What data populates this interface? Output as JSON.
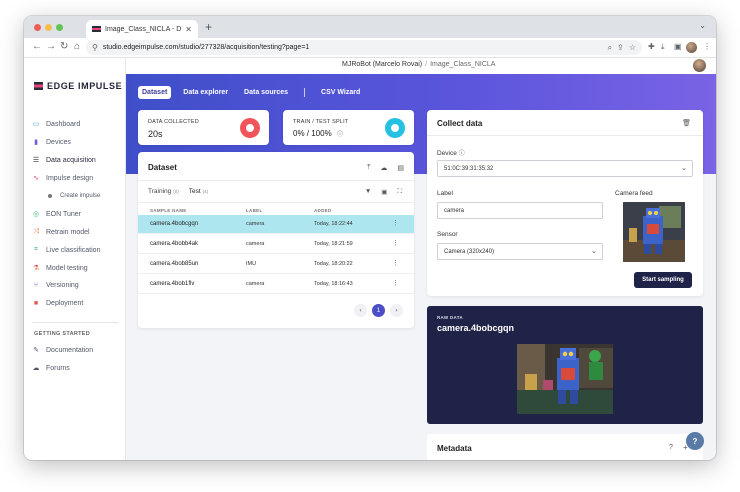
{
  "browser": {
    "tab_title": "Image_Class_NICLA - Da",
    "url": "studio.edgeimpulse.com/studio/277328/acquisition/testing?page=1",
    "traffic_colors": [
      "#ec5f57",
      "#f5bd4f",
      "#61c454"
    ]
  },
  "app": {
    "logo_text": "EDGE IMPULSE",
    "breadcrumb": {
      "user": "MJRoBot (Marcelo Rovai)",
      "separator": "/",
      "project": "Image_Class_NICLA"
    }
  },
  "sidebar": {
    "items": [
      {
        "label": "Dashboard",
        "icon": "monitor-icon",
        "color": "#4b9cd3"
      },
      {
        "label": "Devices",
        "icon": "device-icon",
        "color": "#6c5fd0"
      },
      {
        "label": "Data acquisition",
        "icon": "database-icon",
        "color": "#2b2c3b"
      },
      {
        "label": "Impulse design",
        "icon": "pulse-icon",
        "color": "#e6477d"
      },
      {
        "label": "Create impulse",
        "icon": "bullet-icon",
        "color": "#777777"
      },
      {
        "label": "EON Tuner",
        "icon": "tuner-icon",
        "color": "#3bb273"
      },
      {
        "label": "Retrain model",
        "icon": "shuffle-icon",
        "color": "#e07b39"
      },
      {
        "label": "Live classification",
        "icon": "scan-icon",
        "color": "#3bb273"
      },
      {
        "label": "Model testing",
        "icon": "flask-icon",
        "color": "#e05a4f"
      },
      {
        "label": "Versioning",
        "icon": "branch-icon",
        "color": "#6c5fd0"
      },
      {
        "label": "Deployment",
        "icon": "package-icon",
        "color": "#e05a4f"
      }
    ],
    "section_title": "GETTING STARTED",
    "getting_started": [
      {
        "label": "Documentation",
        "icon": "book-icon"
      },
      {
        "label": "Forums",
        "icon": "chat-icon"
      }
    ]
  },
  "subtabs": [
    "Dataset",
    "Data explorer",
    "Data sources",
    "CSV Wizard"
  ],
  "stats": {
    "collected_label": "DATA COLLECTED",
    "collected_value": "20s",
    "split_label": "TRAIN / TEST SPLIT",
    "split_value": "0% / 100%",
    "collected_ring_color": "#f2545b",
    "split_ring_color": "#26c0e0"
  },
  "dataset": {
    "title": "Dataset",
    "tabs": [
      {
        "label": "Training",
        "count": "(0)"
      },
      {
        "label": "Test",
        "count": "(4)"
      }
    ],
    "columns": [
      "SAMPLE NAME",
      "LABEL",
      "ADDED"
    ],
    "rows": [
      {
        "name": "camera.4bobcgqn",
        "label": "camera",
        "added": "Today, 18:22:44",
        "selected": true
      },
      {
        "name": "camera.4bobb4ak",
        "label": "camera",
        "added": "Today, 18:21:59",
        "selected": false
      },
      {
        "name": "camera.4bob85un",
        "label": "IMU",
        "added": "Today, 18:20:22",
        "selected": false
      },
      {
        "name": "camera.4bob1flv",
        "label": "camera",
        "added": "Today, 18:16:43",
        "selected": false
      }
    ],
    "pager": {
      "prev": "‹",
      "current": "1",
      "next": "›"
    }
  },
  "collect": {
    "title": "Collect data",
    "device_label": "Device",
    "device_value": "51:0C:39:31:35:32",
    "label_label": "Label",
    "label_value": "camera",
    "sensor_label": "Sensor",
    "sensor_value": "Camera (320x240)",
    "camera_feed_label": "Camera feed",
    "start_button": "Start sampling"
  },
  "raw": {
    "label": "RAW DATA",
    "name": "camera.4bobcgqn"
  },
  "metadata": {
    "title": "Metadata",
    "help": "?",
    "add": "+"
  },
  "fab": "?"
}
